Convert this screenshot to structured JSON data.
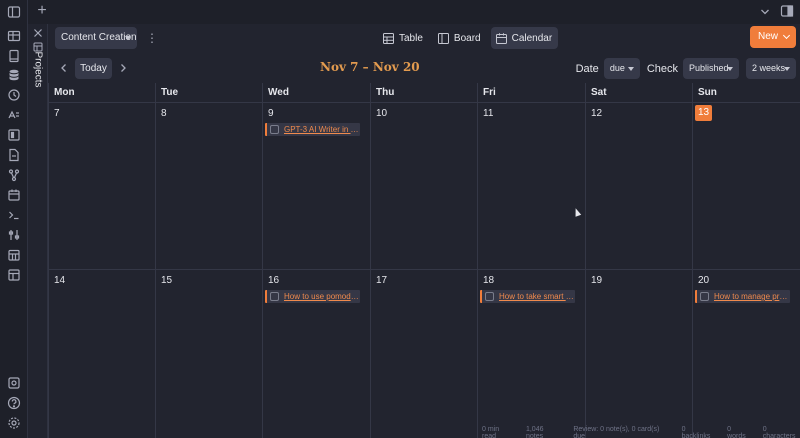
{
  "ribbon": {
    "icons": [
      "sidebar-toggle-icon",
      "gallery-icon",
      "book-icon",
      "database-icon",
      "clock-icon",
      "reading-icon",
      "kanban-icon",
      "file-icon",
      "graph-icon",
      "calendar-icon",
      "terminal-icon",
      "sliders-icon",
      "calendar-grid-icon",
      "layout-icon"
    ],
    "bottom_icons": [
      "vault-icon",
      "help-icon",
      "settings-icon"
    ]
  },
  "side_panel": {
    "label": "Projects"
  },
  "toolbar": {
    "project": "Content Creation",
    "views": [
      {
        "label": "Table",
        "icon": "table-icon"
      },
      {
        "label": "Board",
        "icon": "board-icon"
      },
      {
        "label": "Calendar",
        "icon": "calendar-icon"
      }
    ],
    "new_label": "New"
  },
  "nav": {
    "today_label": "Today",
    "range_title": "Nov 7 – Nov 20",
    "date_label": "Date",
    "date_value": "due",
    "check_label": "Check",
    "check_value": "Published",
    "span_value": "2 weeks"
  },
  "calendar": {
    "weekdays": [
      "Mon",
      "Tue",
      "Wed",
      "Thu",
      "Fri",
      "Sat",
      "Sun"
    ],
    "weeks": [
      {
        "days": [
          "7",
          "8",
          "9",
          "10",
          "11",
          "12",
          "13"
        ]
      },
      {
        "days": [
          "14",
          "15",
          "16",
          "17",
          "18",
          "19",
          "20"
        ]
      }
    ],
    "today": "13",
    "events": {
      "week0_wed": "GPT-3 AI Writer in o...",
      "week1_wed": "How to use pomodo...",
      "week1_fri": "How to take smart n...",
      "week1_sun": "How to manage proj..."
    }
  },
  "statusbar": {
    "read_time": "0 min read",
    "notes": "1,046 notes",
    "review": "Review: 0 note(s), 0 card(s) due",
    "backlinks": "0 backlinks",
    "words": "0 words",
    "characters": "0 characters"
  },
  "colors": {
    "accent": "#f07d3b",
    "title": "#e39b4f",
    "background": "#22242f"
  }
}
